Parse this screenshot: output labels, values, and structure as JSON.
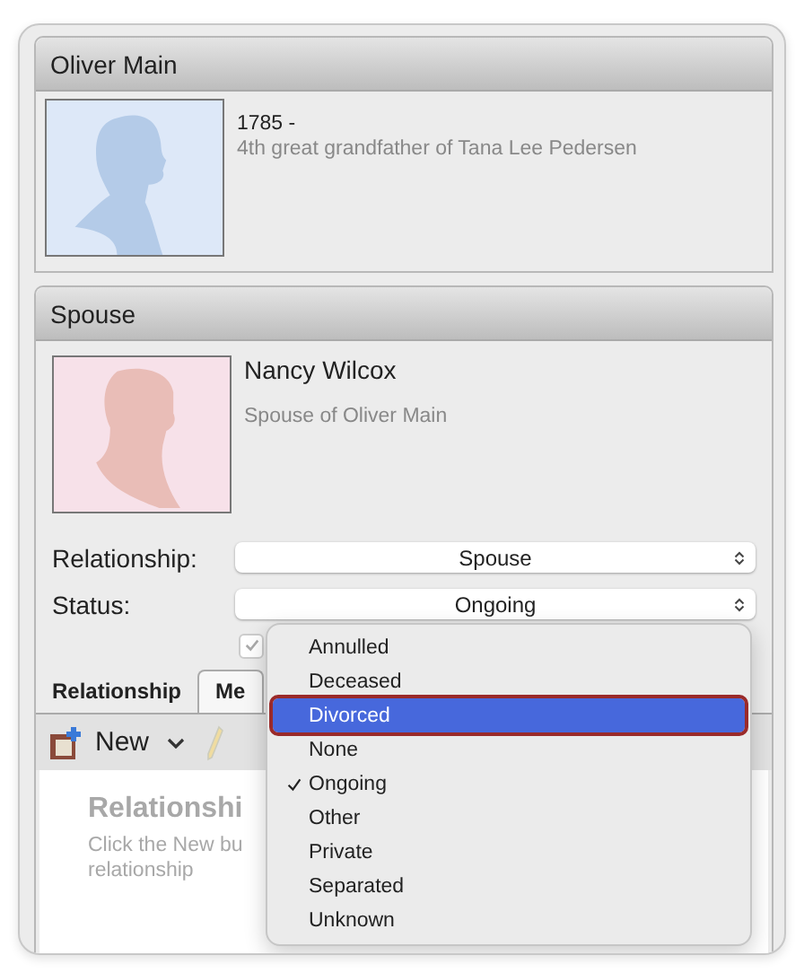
{
  "person": {
    "name": "Oliver Main",
    "dates": "1785 -",
    "relation": "4th great grandfather of Tana Lee Pedersen",
    "photo": {
      "kind": "male"
    }
  },
  "spouse": {
    "header": "Spouse",
    "name": "Nancy Wilcox",
    "relation": "Spouse of Oliver Main",
    "photo": {
      "kind": "female"
    },
    "fields": [
      {
        "label": "Relationship:",
        "value": "Spouse"
      },
      {
        "label": "Status:",
        "value": "Ongoing"
      }
    ],
    "checkbox": {
      "checked": true,
      "disabled": true
    },
    "tabs": [
      {
        "label": "Relationship",
        "selected": false
      },
      {
        "label": "Me",
        "selected": true
      }
    ],
    "toolbar": {
      "new_label": "New"
    },
    "empty": {
      "title": "Relationshi",
      "lines": [
        "Click the New bu",
        "relationship"
      ]
    }
  },
  "status_menu": [
    {
      "label": "Annulled",
      "checked": false,
      "highlighted": false
    },
    {
      "label": "Deceased",
      "checked": false,
      "highlighted": false
    },
    {
      "label": "Divorced",
      "checked": false,
      "highlighted": true
    },
    {
      "label": "None",
      "checked": false,
      "highlighted": false
    },
    {
      "label": "Ongoing",
      "checked": true,
      "highlighted": false
    },
    {
      "label": "Other",
      "checked": false,
      "highlighted": false
    },
    {
      "label": "Private",
      "checked": false,
      "highlighted": false
    },
    {
      "label": "Separated",
      "checked": false,
      "highlighted": false
    },
    {
      "label": "Unknown",
      "checked": false,
      "highlighted": false
    }
  ]
}
